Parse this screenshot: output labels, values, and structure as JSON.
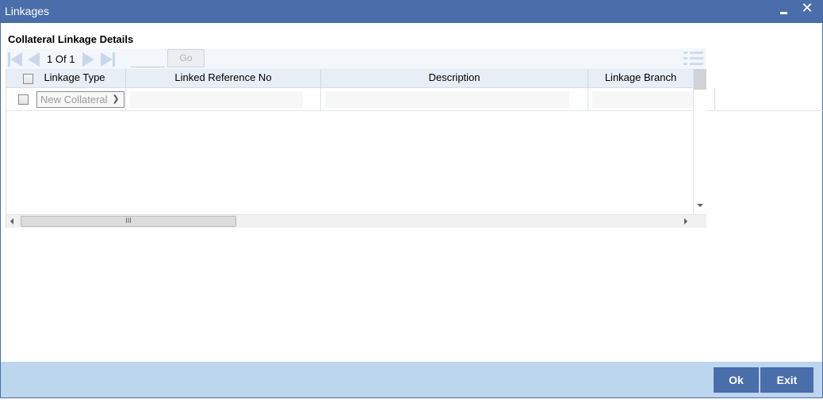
{
  "window": {
    "title": "Linkages",
    "minimize_label": "",
    "close_label": "✕"
  },
  "section": {
    "title": "Collateral Linkage Details"
  },
  "pagination": {
    "current_page": "1",
    "of_label": "Of",
    "total_pages": "1",
    "page_input_value": "",
    "go_label": "Go"
  },
  "grid": {
    "columns": [
      {
        "label": "Linkage Type"
      },
      {
        "label": "Linked Reference No"
      },
      {
        "label": "Description"
      },
      {
        "label": "Linkage Branch"
      }
    ],
    "rows": [
      {
        "linkage_type": "New Collateral",
        "linked_reference_no": "",
        "description": "",
        "linkage_branch": ""
      }
    ],
    "hscroll_grip": "III"
  },
  "footer": {
    "ok_label": "Ok",
    "exit_label": "Exit"
  },
  "colors": {
    "titlebar": "#4a6ea9",
    "footer": "#bcd6ee",
    "grid_header": "#e8eef6"
  }
}
